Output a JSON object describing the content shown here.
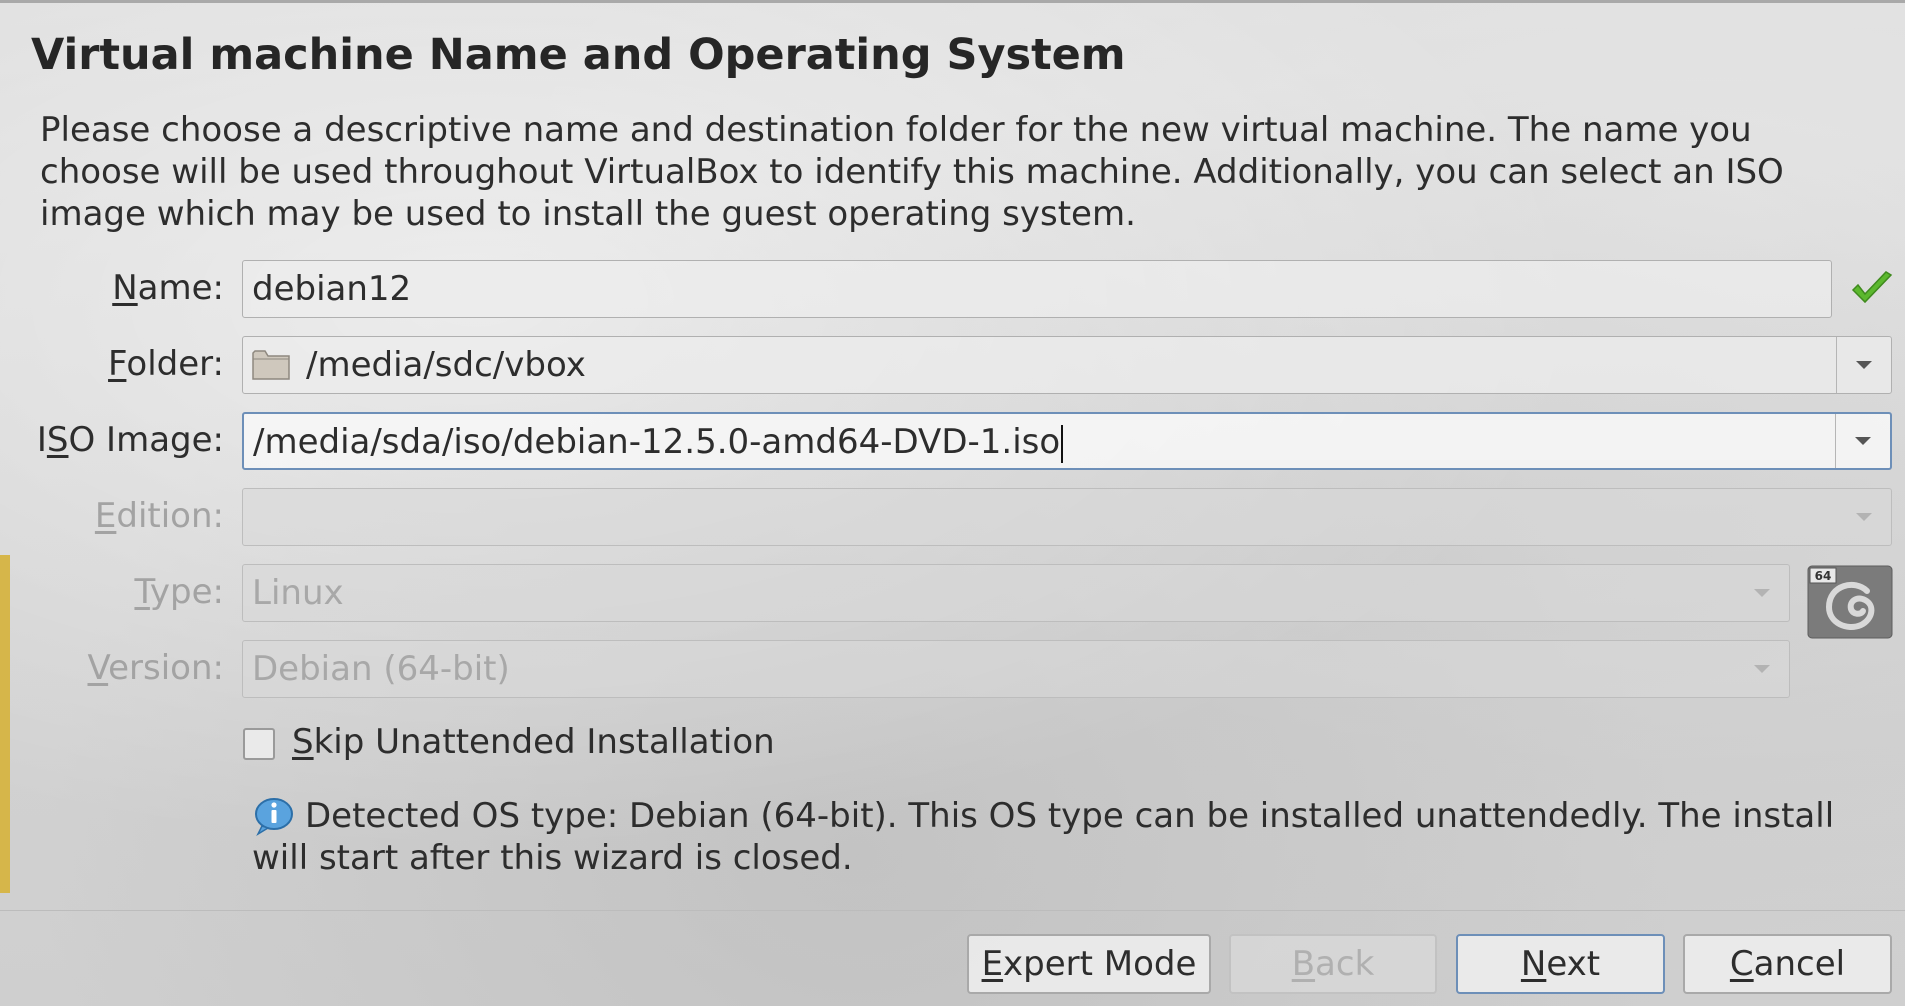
{
  "title": "Virtual machine Name and Operating System",
  "description": "Please choose a descriptive name and destination folder for the new virtual machine. The name you choose will be used throughout VirtualBox to identify this machine. Additionally, you can select an ISO image which may be used to install the guest operating system.",
  "form": {
    "name": {
      "label_mnemonic": "N",
      "label_rest": "ame:",
      "value": "debian12"
    },
    "folder": {
      "label_mnemonic": "F",
      "label_rest": "older:",
      "value": "/media/sdc/vbox"
    },
    "iso": {
      "label_prefix": "I",
      "label_mnemonic": "S",
      "label_rest": "O Image:",
      "value": "/media/sda/iso/debian-12.5.0-amd64-DVD-1.iso"
    },
    "edition": {
      "label_mnemonic": "E",
      "label_rest": "dition:",
      "value": ""
    },
    "type": {
      "label_mnemonic": "T",
      "label_rest": "ype:",
      "value": "Linux"
    },
    "version": {
      "label_mnemonic": "V",
      "label_rest": "ersion:",
      "value": "Debian (64-bit)"
    }
  },
  "os_icon": {
    "badge": "64",
    "icon": "debian-swirl-icon"
  },
  "skip_unattended": {
    "label_mnemonic": "S",
    "label_rest": "kip Unattended Installation",
    "checked": false
  },
  "info": "Detected OS type: Debian (64-bit). This OS type can be installed unattendedly. The install will start after this wizard is closed.",
  "buttons": {
    "expert": {
      "mnemonic": "E",
      "rest": "xpert Mode"
    },
    "back": {
      "mnemonic": "B",
      "rest": "ack"
    },
    "next": {
      "mnemonic": "N",
      "rest": "ext"
    },
    "cancel": {
      "mnemonic": "C",
      "rest": "ancel"
    }
  },
  "colors": {
    "accent_focus": "#6d8fb8",
    "check_green": "#5cb82e",
    "left_accent": "#d6b64a"
  }
}
